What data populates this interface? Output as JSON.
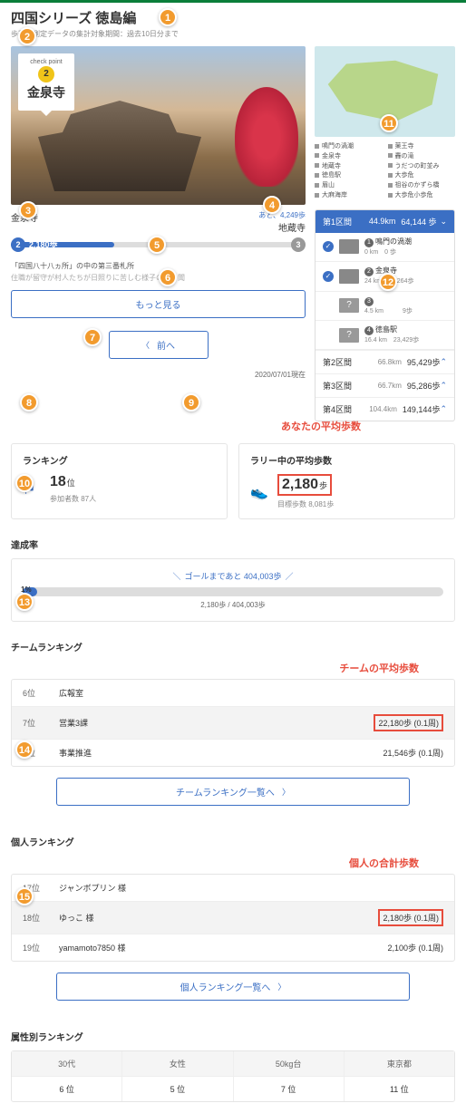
{
  "header": {
    "title": "四国シリーズ 徳島編",
    "subtitle": "歩数計測定データの集計対象期間：過去10日分まで"
  },
  "checkpoint": {
    "label": "check point",
    "number": "2",
    "name": "金泉寺"
  },
  "map_legend": {
    "left": [
      "鳴門の渦潮",
      "金泉寺",
      "地蔵寺",
      "徳島駅",
      "眉山",
      "大麻海岸"
    ],
    "right": [
      "薬王寺",
      "轟の滝",
      "うだつの町並み",
      "大歩危",
      "祖谷のかずら橋",
      "大歩危小歩危"
    ]
  },
  "poi": {
    "left": "金泉寺",
    "right": "地蔵寺",
    "remain": "あと、4,249歩"
  },
  "progress": {
    "start": "2",
    "end": "3",
    "steps": "2,180歩"
  },
  "desc": {
    "head": "「四国八十八ヵ所」の中の第三番札所",
    "body": "住職が留守が村人たちが日照りに苦しむ様子の水を聞"
  },
  "buttons": {
    "more": "もっと見る",
    "prev": "前へ",
    "team_rank": "チームランキング一覧へ",
    "indiv_rank": "個人ランキング一覧へ"
  },
  "date": "2020/07/01現在",
  "sections": {
    "s1": {
      "title": "第1区間",
      "km": "44.9km",
      "steps": "64,144 歩",
      "items": [
        {
          "num": "1",
          "name": "鳴門の渦潮",
          "sub": "0 km　0 歩",
          "done": true
        },
        {
          "num": "2",
          "name": "金泉寺",
          "sub": "24 km　34,264歩",
          "done": true
        },
        {
          "num": "3",
          "name": "",
          "sub": "4.5 km　　　9歩",
          "done": false
        },
        {
          "num": "4",
          "name": "徳島駅",
          "sub": "16.4 km　23,429歩",
          "done": false
        }
      ]
    },
    "rows": [
      {
        "title": "第2区間",
        "km": "66.8km",
        "steps": "95,429歩"
      },
      {
        "title": "第3区間",
        "km": "66.7km",
        "steps": "95,286歩"
      },
      {
        "title": "第4区間",
        "km": "104.4km",
        "steps": "149,144歩"
      }
    ]
  },
  "stats": {
    "ranking": {
      "title": "ランキング",
      "value": "18",
      "unit": "位",
      "sub_label": "参加者数",
      "sub_value": "87",
      "sub_unit": "人"
    },
    "avg": {
      "title": "ラリー中の平均歩数",
      "value": "2,180",
      "unit": "歩",
      "sub_label": "目標歩数",
      "sub_value": "8,081",
      "sub_unit": "歩"
    }
  },
  "notes": {
    "avg": "あなたの平均歩数",
    "team": "チームの平均歩数",
    "indiv": "個人の合計歩数"
  },
  "achieve": {
    "title": "達成率",
    "pct": "1",
    "goal": "ゴールまであと 404,003歩",
    "sub": "2,180歩 / 404,003歩"
  },
  "team_rank": {
    "title": "チームランキング",
    "rows": [
      {
        "pos": "6位",
        "name": "広報室",
        "val": ""
      },
      {
        "pos": "7位",
        "name": "営業3課",
        "val": "22,180歩 (0.1周)",
        "me": true
      },
      {
        "pos": "8位",
        "name": "事業推進",
        "val": "21,546歩 (0.1周)"
      }
    ]
  },
  "indiv_rank": {
    "title": "個人ランキング",
    "rows": [
      {
        "pos": "17位",
        "name": "ジャンボプリン 様",
        "val": ""
      },
      {
        "pos": "18位",
        "name": "ゆっこ 様",
        "val": "2,180歩 (0.1周)",
        "me": true
      },
      {
        "pos": "19位",
        "name": "yamamoto7850 様",
        "val": "2,100歩 (0.1周)"
      }
    ]
  },
  "attr_rank": {
    "title": "属性別ランキング",
    "heads": [
      "30代",
      "女性",
      "50kg台",
      "東京都"
    ],
    "vals": [
      "6 位",
      "5 位",
      "7 位",
      "11 位"
    ]
  },
  "callouts": [
    "1",
    "2",
    "3",
    "4",
    "5",
    "6",
    "7",
    "8",
    "9",
    "10",
    "11",
    "12",
    "13",
    "14",
    "15"
  ]
}
